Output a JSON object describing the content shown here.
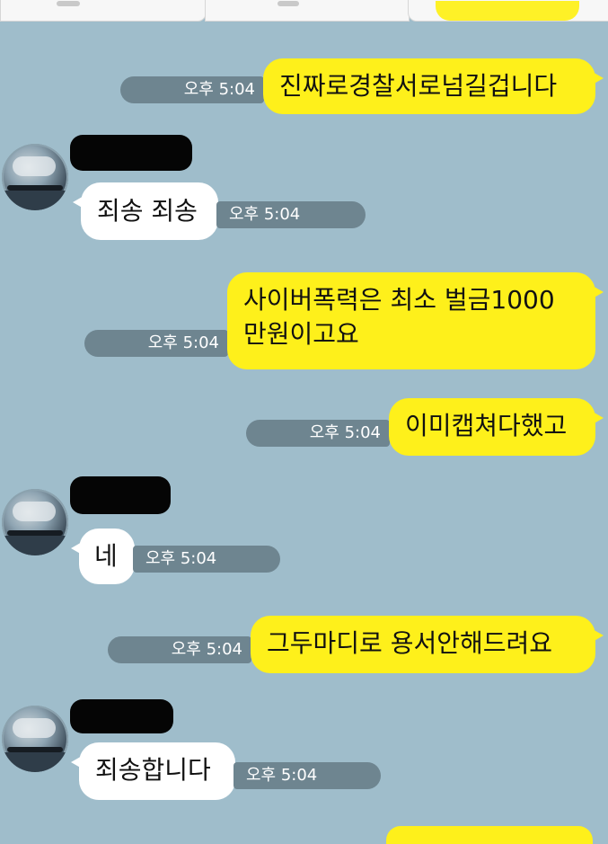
{
  "messages": [
    {
      "side": "mine",
      "text": "진짜로경찰서로넘길겁니다",
      "time": "오후 5:04"
    },
    {
      "side": "theirs",
      "text": "죄송 죄송",
      "time": "오후 5:04"
    },
    {
      "side": "mine",
      "lines": [
        "사이버폭력은 최소 벌금1000",
        "만원이고요"
      ],
      "time": "오후 5:04"
    },
    {
      "side": "mine",
      "text": "이미캡쳐다했고",
      "time": "오후 5:04"
    },
    {
      "side": "theirs",
      "text": "네",
      "time": "오후 5:04"
    },
    {
      "side": "mine",
      "text": "그두마디로 용서안해드려요",
      "time": "오후 5:04"
    },
    {
      "side": "theirs",
      "text": "죄송합니다",
      "time": "오후 5:04"
    }
  ],
  "colors": {
    "background": "#9fbdcb",
    "my_bubble": "#fef01b",
    "their_bubble": "#ffffff",
    "time_pill": "#6e8590"
  },
  "icons": {
    "avatar": "profile-avatar-sunset-sea"
  }
}
